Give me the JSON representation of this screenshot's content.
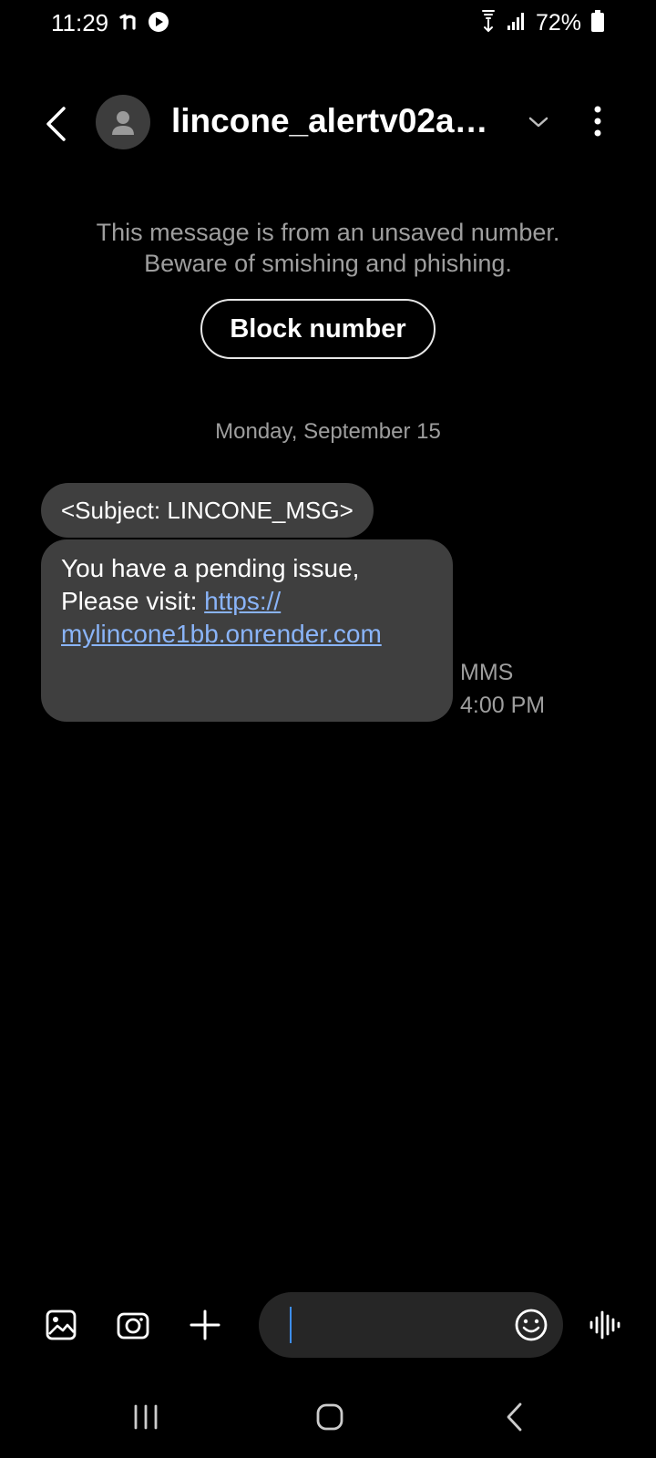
{
  "status_bar": {
    "time": "11:29",
    "battery_percent": "72%",
    "icons": [
      "notification-n-icon",
      "play-icon",
      "wifi-calling-icon",
      "signal-icon",
      "battery-icon"
    ]
  },
  "header": {
    "contact": "lincone_alertv02a@...",
    "icons": [
      "back-arrow-icon",
      "person-icon",
      "chevron-down-icon",
      "more-vertical-icon"
    ]
  },
  "warning": {
    "line1": "This message is from an unsaved number.",
    "line2": "Beware of smishing and phishing.",
    "block_label": "Block number"
  },
  "conversation": {
    "date": "Monday, September 15",
    "subject": "<Subject: LINCONE_MSG>",
    "body_line1": "You have a pending issue,",
    "body_prefix": "Please visit: ",
    "link_part1": "https://",
    "link_part2": "mylincone1bb.onrender.com",
    "type": "MMS",
    "time": "4:00 PM"
  },
  "composer": {
    "placeholder": "",
    "icons": [
      "gallery-icon",
      "camera-icon",
      "plus-icon",
      "emoji-icon",
      "voice-waveform-icon"
    ]
  },
  "navbar": {
    "icons": [
      "recent-apps-icon",
      "home-icon",
      "nav-back-icon"
    ]
  },
  "colors": {
    "background": "#000000",
    "bubble": "#3f3f3f",
    "link": "#8ab4f8",
    "caret": "#3d8ef2",
    "muted_text": "#9e9e9e"
  }
}
